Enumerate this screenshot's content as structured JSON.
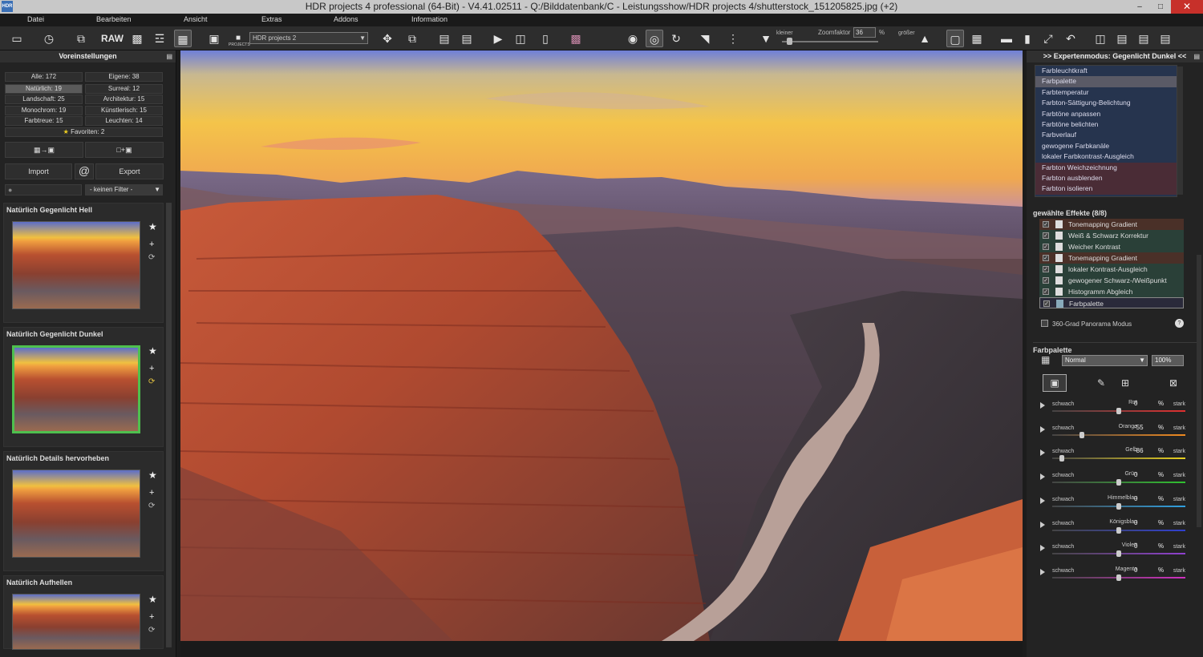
{
  "window": {
    "title": "HDR projects 4 professional (64-Bit) - V4.41.02511 - Q:/Bilddatenbank/C - Leistungsshow/HDR projects 4/shutterstock_151205825.jpg (+2)",
    "logo": "HDR",
    "minimize": "–",
    "maximize": "□",
    "close": "✕"
  },
  "menu": [
    "Datei",
    "Bearbeiten",
    "Ansicht",
    "Extras",
    "Addons",
    "Information"
  ],
  "toolbar": {
    "raw_label": "RAW",
    "project_select": "HDR projects 2",
    "projects_label": "PROJECTS",
    "zoom_smaller": "kleiner",
    "zoom_label": "Zoomfaktor",
    "zoom_value": "36",
    "zoom_unit": "%",
    "zoom_bigger": "größer",
    "zoom_level": 0.05
  },
  "left_panel": {
    "title": "Voreinstellungen",
    "categories": [
      "Alle: 172",
      "Eigene: 38",
      "Natürlich: 19",
      "Surreal: 12",
      "Landschaft: 25",
      "Architektur: 15",
      "Monochrom: 19",
      "Künstlerisch: 15",
      "Farbtreue: 15",
      "Leuchten: 14"
    ],
    "favorites": "Favoriten: 2",
    "import_label": "Import",
    "export_label": "Export",
    "at_label": "@",
    "filter_label": "- keinen Filter -",
    "presets": [
      "Natürlich Gegenlicht Hell",
      "Natürlich Gegenlicht Dunkel",
      "Natürlich Details hervorheben",
      "Natürlich Aufhellen"
    ]
  },
  "right_panel": {
    "title": ">> Expertenmodus: Gegenlicht Dunkel <<",
    "list": [
      "Farbleuchtkraft",
      "Farbpalette",
      "Farbtemperatur",
      "Farbton-Sättigung-Belichtung",
      "Farbtöne anpassen",
      "Farbtöne belichten",
      "Farbverlauf",
      "gewogene Farbkanäle",
      "lokaler Farbkontrast-Ausgleich",
      "Farbton Weichzeichnung",
      "Farbton ausblenden",
      "Farbton isolieren"
    ],
    "effects_title": "gewählte Effekte (8/8)",
    "effects": [
      "Tonemapping Gradient",
      "Weiß & Schwarz Korrektur",
      "Weicher Kontrast",
      "Tonemapping Gradient",
      "lokaler Kontrast-Ausgleich",
      "gewogener Schwarz-/Weißpunkt",
      "Histogramm Abgleich",
      "Farbpalette"
    ],
    "panorama_label": "360-Grad Panorama Modus",
    "palette_title": "Farbpalette",
    "blend_mode": "Normal",
    "opacity": "100%",
    "weak_label": "schwach",
    "strong_label": "stark",
    "percent": "%",
    "sliders": [
      {
        "name": "Rot",
        "value": "0",
        "color": "#e03030"
      },
      {
        "name": "Orange",
        "value": "-55",
        "color": "#f08a20"
      },
      {
        "name": "Gelb",
        "value": "-86",
        "color": "#e8d020"
      },
      {
        "name": "Grün",
        "value": "0",
        "color": "#30c030"
      },
      {
        "name": "Himmelblau",
        "value": "0",
        "color": "#30a0e0"
      },
      {
        "name": "Königsblau",
        "value": "0",
        "color": "#3040d0"
      },
      {
        "name": "Violett",
        "value": "0",
        "color": "#9040d0"
      },
      {
        "name": "Magenta",
        "value": "0",
        "color": "#d030c0"
      }
    ]
  },
  "colors": {
    "accent_selected_thumb": "#4ec04e",
    "list_bg": "#26344e"
  }
}
